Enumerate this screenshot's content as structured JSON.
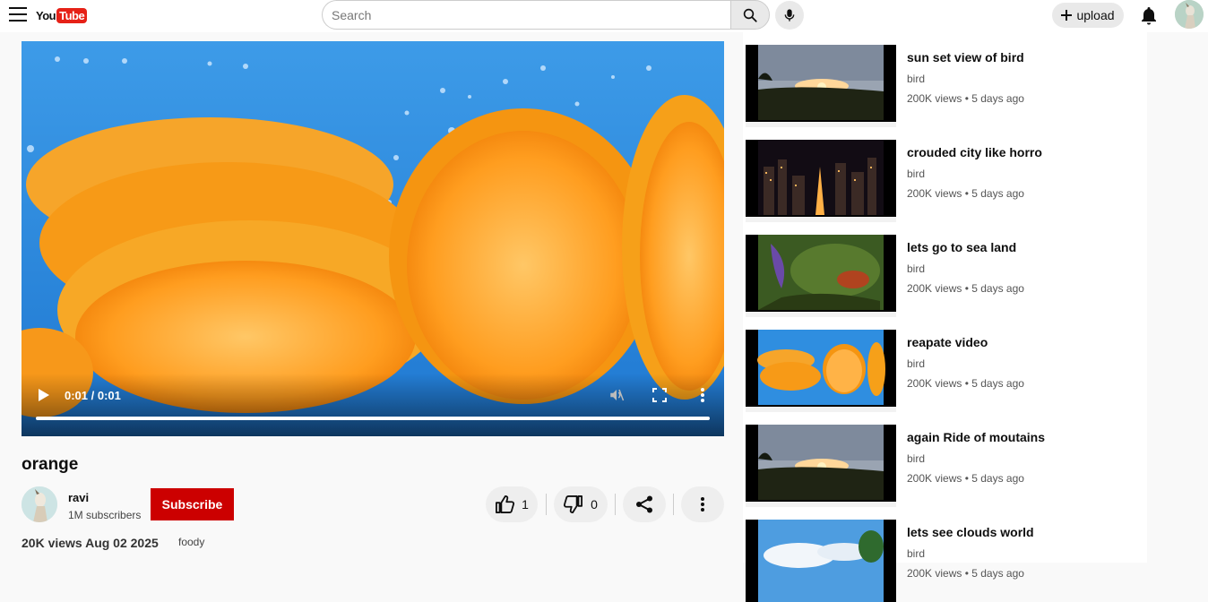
{
  "header": {
    "logo_you": "You",
    "logo_tube": "Tube",
    "search_placeholder": "Search",
    "upload_label": "upload"
  },
  "player": {
    "time": "0:01 / 0:01",
    "progress_fraction": 1.0
  },
  "video": {
    "title": "orange",
    "channel": "ravi",
    "subscribers": "1M subscribers",
    "subscribe_label": "Subscribe",
    "likes": "1",
    "dislikes": "0",
    "views_date": "20K views Aug 02 2025",
    "category": "foody"
  },
  "recommendations": [
    {
      "title": "sun set view of bird",
      "channel": "bird",
      "meta": "200K views • 5 days ago",
      "thumb": "sunset"
    },
    {
      "title": "crouded city like horro",
      "channel": "bird",
      "meta": "200K views • 5 days ago",
      "thumb": "city"
    },
    {
      "title": "lets go to sea land",
      "channel": "bird",
      "meta": "200K views • 5 days ago",
      "thumb": "sea"
    },
    {
      "title": "reapate video",
      "channel": "bird",
      "meta": "200K views • 5 days ago",
      "thumb": "orange"
    },
    {
      "title": "again Ride of moutains",
      "channel": "bird",
      "meta": "200K views • 5 days ago",
      "thumb": "sunset"
    },
    {
      "title": "lets see clouds world",
      "channel": "bird",
      "meta": "200K views • 5 days ago",
      "thumb": "clouds"
    }
  ],
  "colors": {
    "brand_red": "#e62117",
    "subscribe_red": "#cc0000",
    "background": "#f9f9f9"
  }
}
